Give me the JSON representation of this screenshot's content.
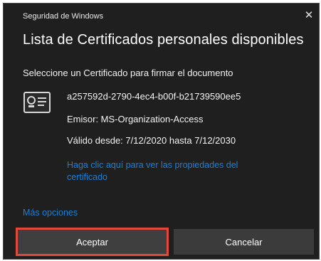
{
  "window": {
    "title": "Seguridad de Windows",
    "close_glyph": "✕"
  },
  "dialog": {
    "heading": "Lista de Certificados personales disponibles",
    "instruction": "Seleccione un Certificado para firmar el documento"
  },
  "certificate": {
    "icon": "certificate-icon",
    "id": "a257592d-2790-4ec4-b00f-b21739590ee5",
    "issuer": "Emisor: MS-Organization-Access",
    "validity": "Válido desde: 7/12/2020 hasta 7/12/2030",
    "properties_link": "Haga clic aquí para ver las propiedades del certificado"
  },
  "more_options": "Más opciones",
  "buttons": {
    "accept": "Aceptar",
    "cancel": "Cancelar"
  },
  "colors": {
    "background": "#1f1f1f",
    "link": "#1d7fd4",
    "highlight": "#e0483a"
  }
}
